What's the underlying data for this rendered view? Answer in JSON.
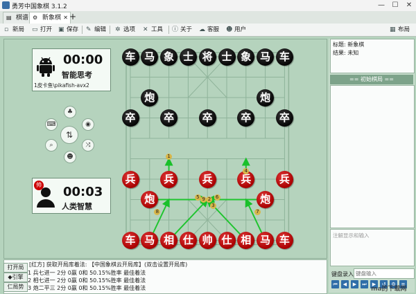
{
  "window": {
    "title": "勇芳中国象棋 3.1.2",
    "minimize": "—",
    "maximize": "☐",
    "close": "✕"
  },
  "tabs": [
    {
      "label": "棋谱",
      "icon": "board-icon"
    },
    {
      "label": "新象棋",
      "icon": "gear-icon",
      "close": "✕",
      "active": true
    }
  ],
  "tab_add": "+",
  "toolbar": {
    "new": "新局",
    "open": "打开",
    "save": "保存",
    "edit": "编辑",
    "options": "选项",
    "tools": "工具",
    "about": "关于",
    "service": "客服",
    "user": "用户",
    "layout": "布局"
  },
  "players": {
    "top": {
      "time": "00:00",
      "name": "智能思考",
      "engine": "1皮卡鱼\\pikafish-avx2"
    },
    "bottom": {
      "time": "00:03",
      "name": "人类智慧",
      "badge": "帅"
    }
  },
  "controls": [
    "tree-icon",
    "gamepad-icon",
    "eye-icon",
    "swap-icon",
    "zoom-icon",
    "user-icon",
    "shuffle-icon"
  ],
  "black_pieces": [
    {
      "c": "车",
      "col": 0,
      "row": 0
    },
    {
      "c": "马",
      "col": 1,
      "row": 0
    },
    {
      "c": "象",
      "col": 2,
      "row": 0
    },
    {
      "c": "士",
      "col": 3,
      "row": 0
    },
    {
      "c": "将",
      "col": 4,
      "row": 0
    },
    {
      "c": "士",
      "col": 5,
      "row": 0
    },
    {
      "c": "象",
      "col": 6,
      "row": 0
    },
    {
      "c": "马",
      "col": 7,
      "row": 0
    },
    {
      "c": "车",
      "col": 8,
      "row": 0
    },
    {
      "c": "炮",
      "col": 1,
      "row": 2
    },
    {
      "c": "炮",
      "col": 7,
      "row": 2
    },
    {
      "c": "卒",
      "col": 0,
      "row": 3
    },
    {
      "c": "卒",
      "col": 2,
      "row": 3
    },
    {
      "c": "卒",
      "col": 4,
      "row": 3
    },
    {
      "c": "卒",
      "col": 6,
      "row": 3
    },
    {
      "c": "卒",
      "col": 8,
      "row": 3
    }
  ],
  "red_pieces": [
    {
      "c": "兵",
      "col": 0,
      "row": 6
    },
    {
      "c": "兵",
      "col": 2,
      "row": 6
    },
    {
      "c": "兵",
      "col": 4,
      "row": 6
    },
    {
      "c": "兵",
      "col": 6,
      "row": 6
    },
    {
      "c": "兵",
      "col": 8,
      "row": 6
    },
    {
      "c": "炮",
      "col": 1,
      "row": 7
    },
    {
      "c": "炮",
      "col": 7,
      "row": 7
    },
    {
      "c": "车",
      "col": 0,
      "row": 9
    },
    {
      "c": "马",
      "col": 1,
      "row": 9
    },
    {
      "c": "相",
      "col": 2,
      "row": 9
    },
    {
      "c": "仕",
      "col": 3,
      "row": 9
    },
    {
      "c": "帅",
      "col": 4,
      "row": 9
    },
    {
      "c": "仕",
      "col": 5,
      "row": 9
    },
    {
      "c": "相",
      "col": 6,
      "row": 9
    },
    {
      "c": "马",
      "col": 7,
      "row": 9
    },
    {
      "c": "车",
      "col": 8,
      "row": 9
    }
  ],
  "hint_numbers": [
    "1",
    "6",
    "2",
    "4",
    "3",
    "5",
    "7",
    "8",
    "9"
  ],
  "info": {
    "title": "标题: 新象棋",
    "result": "结果: 未知"
  },
  "opening_header": "== 初始棋局 ==",
  "comment_placeholder": "注解显示和输入",
  "record_input": {
    "label": "键盘录入",
    "placeholder": "键盘输入"
  },
  "movelist": {
    "buttons": [
      "打开局",
      "◆引擎",
      "仁局势"
    ],
    "header": "[红方] 获取开局库着法: 【中国象棋云开局库】(双击设置开局库)",
    "rows": [
      "1  兵七进一  2分  0赢  0和  50.15%胜率  最佳着法",
      "2  相七进一  2分  0赢  0和  50.15%胜率  最佳着法",
      "3  炮二平三  2分  0赢  0和  50.15%胜率  最佳着法"
    ]
  },
  "nav_buttons": [
    "⏮",
    "◀",
    "▶",
    "⏭",
    "▶",
    "↺",
    "⚙",
    "≡"
  ],
  "watermark": "ma的下载网"
}
